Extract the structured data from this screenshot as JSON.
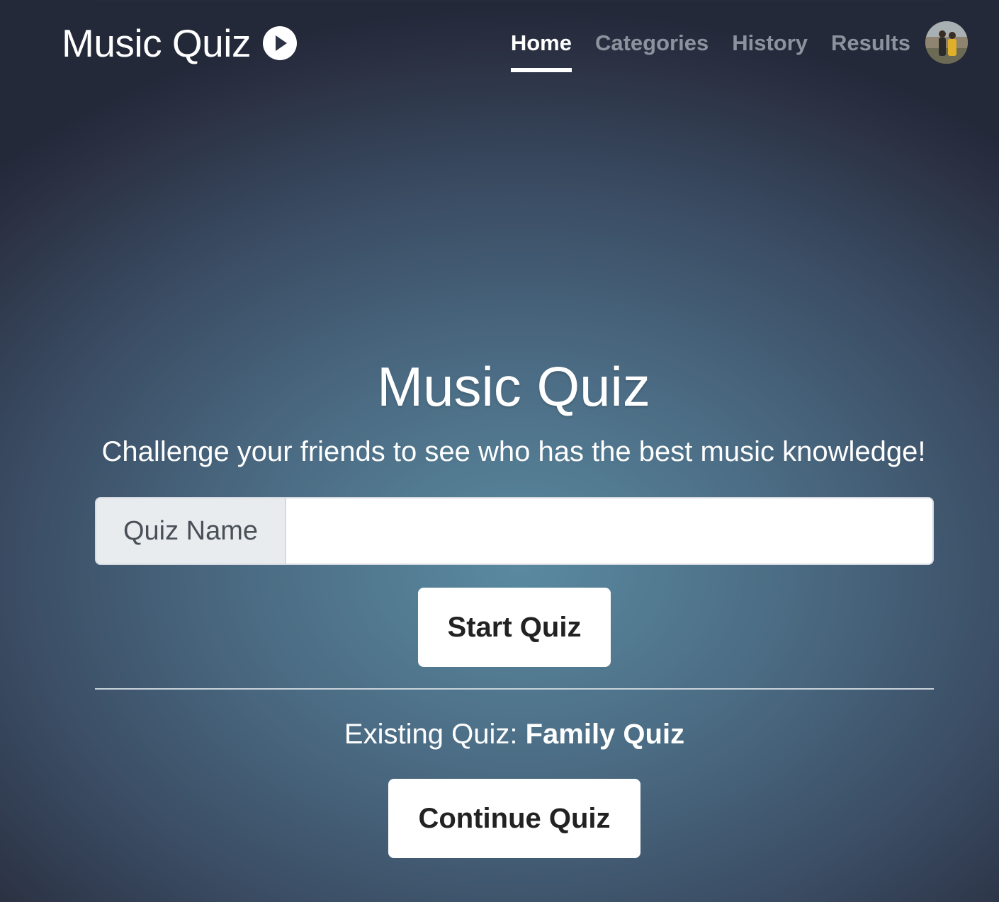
{
  "navbar": {
    "brand": "Music Quiz",
    "brand_icon": "play-circle-icon",
    "links": [
      {
        "label": "Home",
        "active": true
      },
      {
        "label": "Categories",
        "active": false
      },
      {
        "label": "History",
        "active": false
      },
      {
        "label": "Results",
        "active": false
      }
    ],
    "avatar_icon": "user-avatar"
  },
  "hero": {
    "title": "Music Quiz",
    "subtitle": "Challenge your friends to see who has the best music knowledge!"
  },
  "form": {
    "input_label": "Quiz Name",
    "input_value": "",
    "start_button": "Start Quiz"
  },
  "existing": {
    "prefix": "Existing Quiz: ",
    "quiz_name": "Family Quiz",
    "continue_button": "Continue Quiz"
  },
  "colors": {
    "nav_inactive": "#8c939e",
    "nav_active": "#ffffff",
    "button_bg": "#ffffff",
    "background_center": "#5a8aa0",
    "background_edge": "#24293a"
  }
}
